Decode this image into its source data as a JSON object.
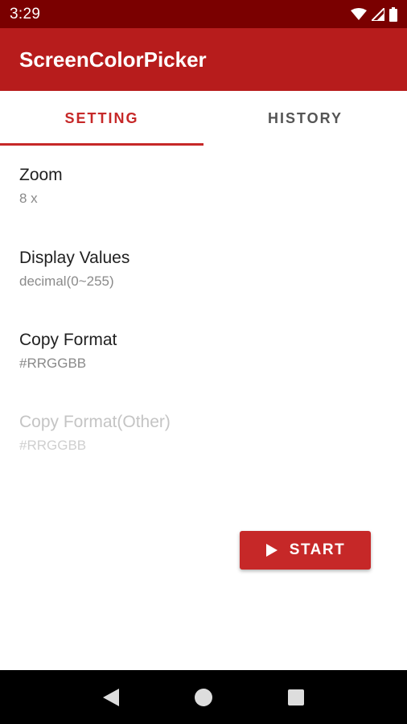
{
  "status_bar": {
    "time": "3:29",
    "icons": [
      "wifi-icon",
      "signal-icon",
      "battery-icon"
    ]
  },
  "app_bar": {
    "title": "ScreenColorPicker",
    "color": "#b71c1c"
  },
  "tabs": [
    {
      "label": "SETTING",
      "active": true
    },
    {
      "label": "HISTORY",
      "active": false
    }
  ],
  "settings": [
    {
      "title": "Zoom",
      "value": "8 x",
      "enabled": true
    },
    {
      "title": "Display Values",
      "value": "decimal(0~255)",
      "enabled": true
    },
    {
      "title": "Copy Format",
      "value": "#RRGGBB",
      "enabled": true
    },
    {
      "title": "Copy Format(Other)",
      "value": "#RRGGBB",
      "enabled": false
    }
  ],
  "start_button": {
    "label": "START",
    "icon": "play-icon",
    "color": "#c62828"
  },
  "nav_bar": {
    "icons": [
      "back-icon",
      "home-icon",
      "recents-icon"
    ]
  }
}
